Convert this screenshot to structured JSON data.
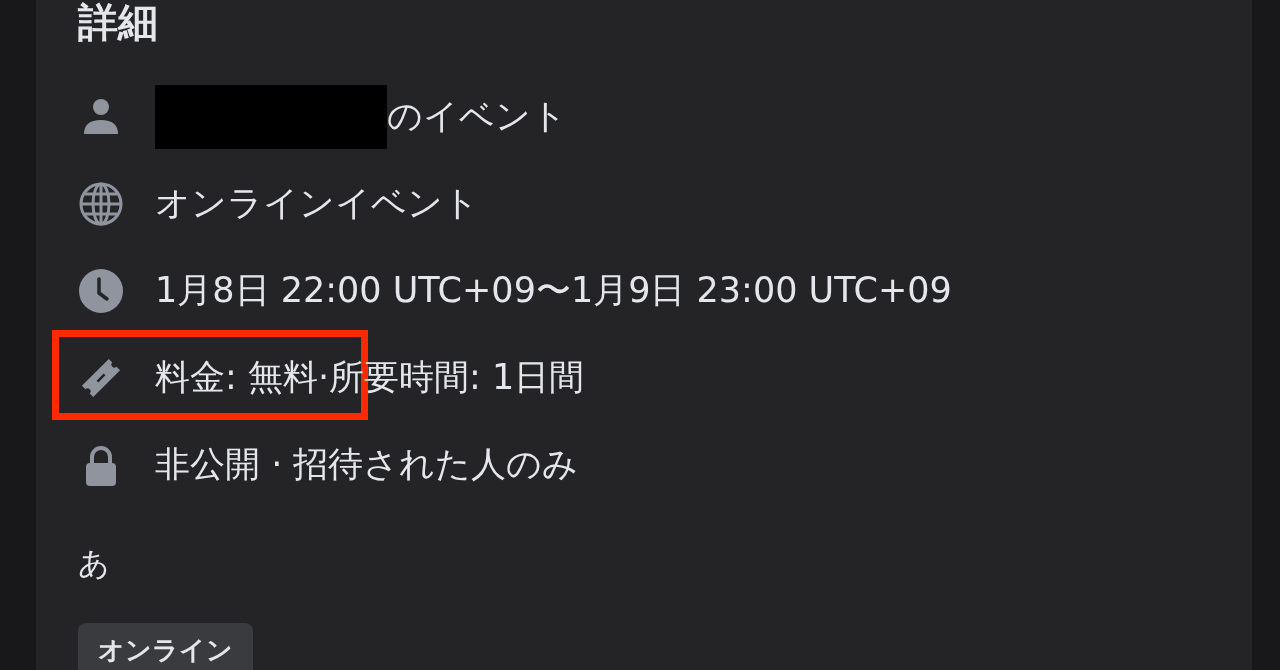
{
  "section_title": "詳細",
  "details": [
    {
      "kind": "host",
      "text": "のイベント",
      "redacted": true,
      "highlighted": false
    },
    {
      "kind": "online",
      "text": "オンラインイベント",
      "redacted": false,
      "highlighted": false
    },
    {
      "kind": "time",
      "text": "1月8日 22:00 UTC+09〜1月9日 23:00 UTC+09",
      "redacted": false,
      "highlighted": false
    },
    {
      "kind": "price",
      "text": "料金: 無料·所要時間: 1日間",
      "redacted": false,
      "highlighted": true
    },
    {
      "kind": "privacy",
      "text": "非公開 · 招待された人のみ",
      "redacted": false,
      "highlighted": false
    }
  ],
  "description": "あ",
  "tags": [
    "オンライン"
  ]
}
